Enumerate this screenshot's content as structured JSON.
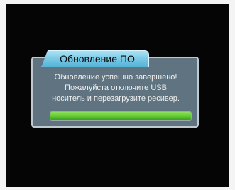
{
  "dialog": {
    "title": "Обновление ПО",
    "message_lines": [
      "Обновление успешно завершено!",
      "Пожалуйста отключите USB",
      "носитель и перезагрузите ресивер."
    ],
    "progress": 1.0
  },
  "colors": {
    "screen_background": "#050505",
    "dialog_background": "#5f7480",
    "title_tab": "#75c6e4",
    "progress_fill": "#5cc52f"
  }
}
